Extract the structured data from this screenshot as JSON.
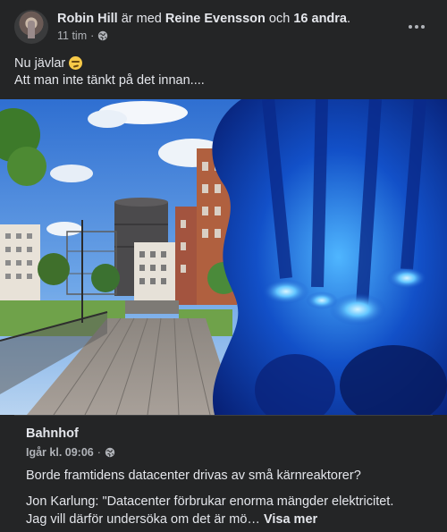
{
  "header": {
    "author": "Robin Hill",
    "with_text": "är med",
    "tagged_person": "Reine Evensson",
    "and_text": "och",
    "others": "16 andra",
    "period": ".",
    "time": "11 tim",
    "sep": "·",
    "avatar_icon": "avatar",
    "privacy_icon": "globe-icon",
    "menu_icon": "more-options-icon"
  },
  "post": {
    "line1": "Nu jävlar",
    "line1_emoji": "grimacing-emoji",
    "line2": "Att man inte tänkt på det innan...."
  },
  "link_card": {
    "site": "Bahnhof",
    "time": "Igår kl. 09:06",
    "sep": "·",
    "title": "Borde framtidens datacenter drivas av små kärnreaktorer?",
    "desc_line1": "Jon Karlung: \"Datacenter förbrukar enorma mängder elektricitet.",
    "desc_line2": "Jag vill därför undersöka om det är mö…",
    "see_more": "Visa mer"
  }
}
